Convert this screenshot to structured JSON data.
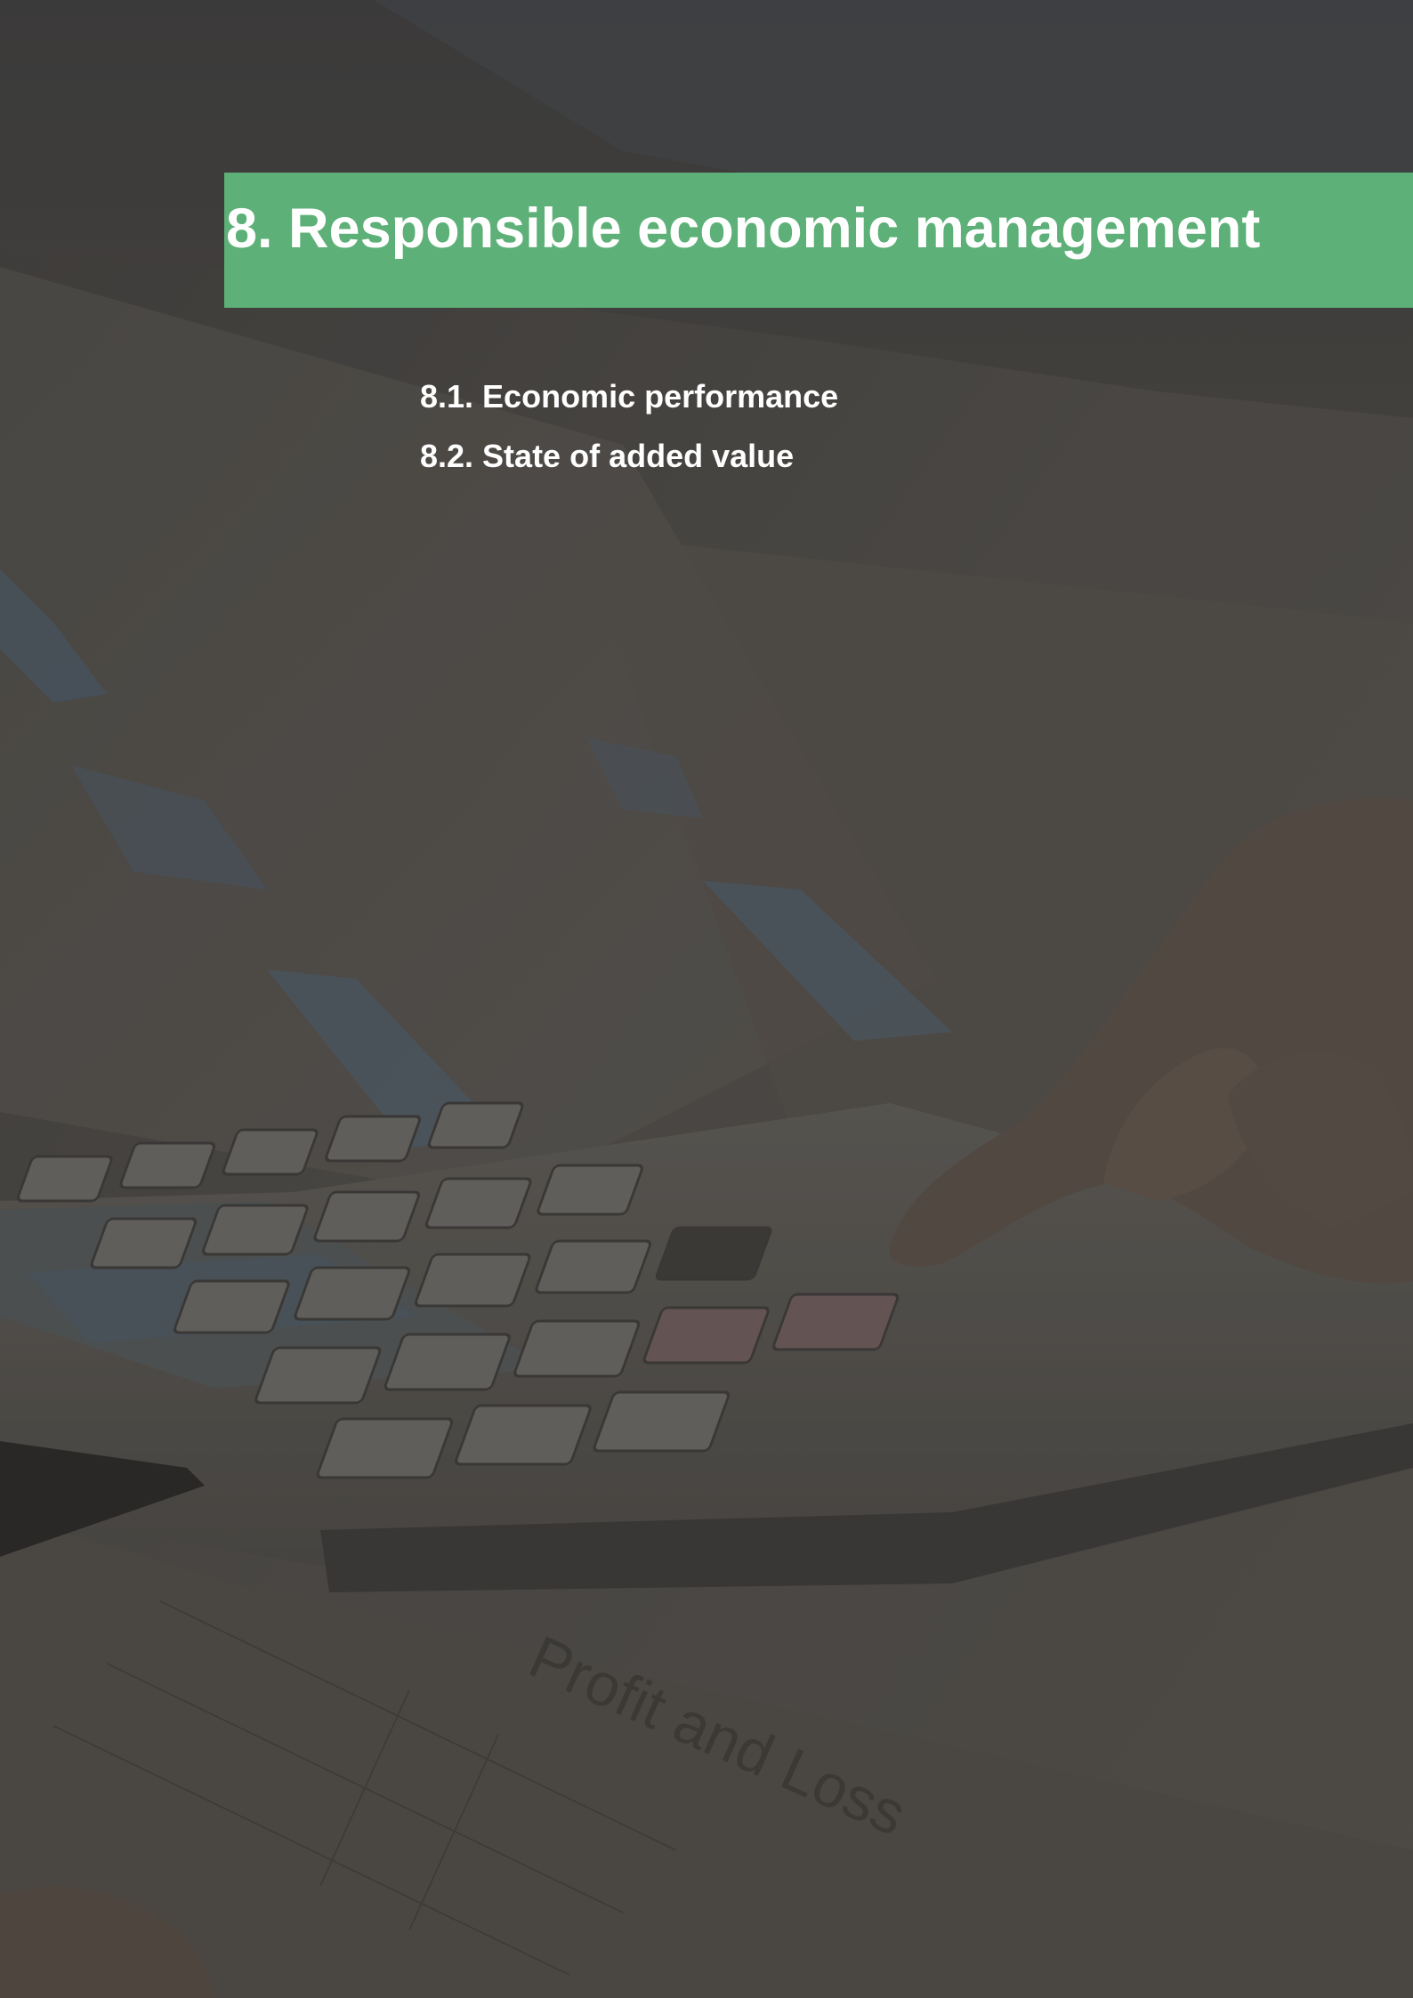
{
  "section": {
    "title": "8. Responsible economic management",
    "accent_color": "#5db077"
  },
  "toc": {
    "items": [
      {
        "label": "8.1. Economic performance"
      },
      {
        "label": "8.2. State of added value"
      }
    ]
  },
  "background": {
    "description_icon": "calculator-photo",
    "overlay_color": "#4a4744"
  }
}
